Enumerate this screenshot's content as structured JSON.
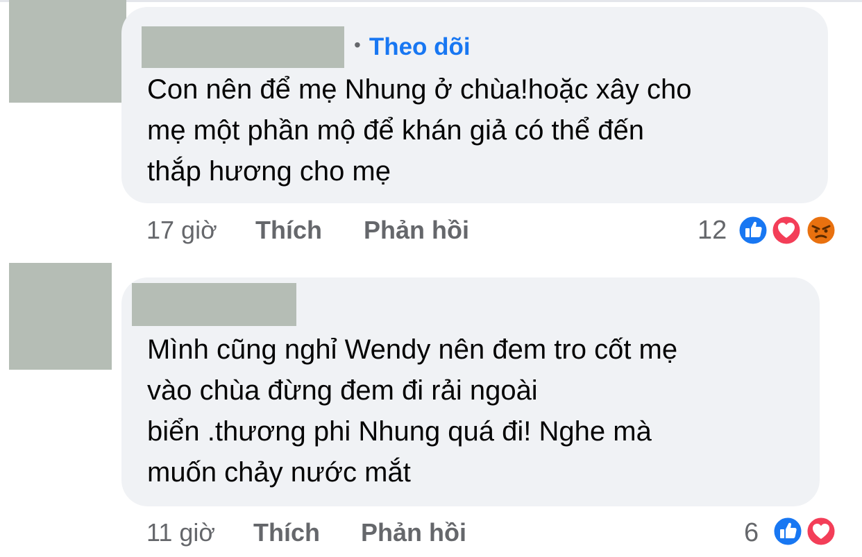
{
  "comments": [
    {
      "follow_label": "Theo dõi",
      "lines": [
        "Con nên để mẹ Nhung ở chùa!hoặc xây cho",
        "mẹ một phần mộ để khán giả có thể đến",
        "thắp hương cho mẹ"
      ],
      "time": "17 giờ",
      "like_label": "Thích",
      "reply_label": "Phản hồi",
      "reaction_count": "12",
      "reactions": [
        "like",
        "love",
        "angry"
      ]
    },
    {
      "lines": [
        "Mình cũng nghỉ Wendy nên đem tro cốt mẹ",
        "vào chùa đừng đem đi rải ngoài",
        "biển .thương phi Nhung quá đi! Nghe mà",
        "muốn chảy nước mắt"
      ],
      "time": "11 giờ",
      "like_label": "Thích",
      "reply_label": "Phản hồi",
      "reaction_count": "6",
      "reactions": [
        "like",
        "love"
      ]
    }
  ],
  "colors": {
    "bubble": "#f0f2f5",
    "redaction": "#b5bdb5",
    "link": "#1877f2",
    "meta": "#65676b",
    "text": "#050505",
    "like": "#1877f2",
    "love": "#f33e58",
    "angry": "#e9710f"
  }
}
